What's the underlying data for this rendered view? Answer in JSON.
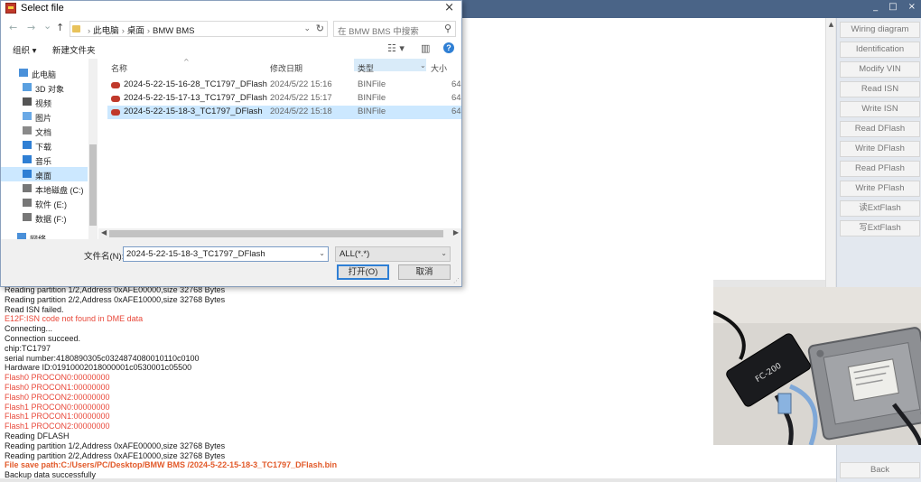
{
  "app": {
    "window_controls": [
      "_",
      "□",
      "×"
    ],
    "right_buttons": [
      "Wiring diagram",
      "Identification",
      "Modify VIN",
      "Read  ISN",
      "Write  ISN",
      "Read DFlash",
      "Write DFlash",
      "Read PFlash",
      "Write PFlash",
      "读ExtFlash",
      "写ExtFlash"
    ],
    "back_label": "Back",
    "scroll_up": "▲",
    "scroll_down": "▼",
    "photo_device_label": "FC-200"
  },
  "log": [
    {
      "text": "Reading partition 1/2,Address 0xAFE00000,size 32768 Bytes",
      "kind": "normal"
    },
    {
      "text": "Reading partition 2/2,Address 0xAFE10000,size 32768 Bytes",
      "kind": "normal"
    },
    {
      "text": "Read ISN failed.",
      "kind": "normal"
    },
    {
      "text": "E12F:ISN code not found in DME data",
      "kind": "err"
    },
    {
      "text": "Connecting...",
      "kind": "normal"
    },
    {
      "text": "Connection succeed.",
      "kind": "normal"
    },
    {
      "text": "chip:TC1797",
      "kind": "normal"
    },
    {
      "text": "serial number:4180890305c0324874080010110c0100",
      "kind": "normal"
    },
    {
      "text": "Hardware ID:01910002018000001c0530001c05500",
      "kind": "normal"
    },
    {
      "text": "Flash0 PROCON0:00000000",
      "kind": "err"
    },
    {
      "text": "Flash0 PROCON1:00000000",
      "kind": "err"
    },
    {
      "text": "Flash0 PROCON2:00000000",
      "kind": "err"
    },
    {
      "text": "Flash1 PROCON0:00000000",
      "kind": "err"
    },
    {
      "text": "Flash1 PROCON1:00000000",
      "kind": "err"
    },
    {
      "text": "Flash1 PROCON2:00000000",
      "kind": "err"
    },
    {
      "text": "Reading DFLASH",
      "kind": "normal"
    },
    {
      "text": "Reading partition 1/2,Address 0xAFE00000,size 32768 Bytes",
      "kind": "normal"
    },
    {
      "text": "Reading partition 2/2,Address 0xAFE10000,size 32768 Bytes",
      "kind": "normal"
    },
    {
      "text": "File save path:C:/Users/PC/Desktop/BMW BMS /2024-5-22-15-18-3_TC1797_DFlash.bin",
      "kind": "warn"
    },
    {
      "text": "Backup data successfully",
      "kind": "normal"
    }
  ],
  "dialog": {
    "title": "Select file",
    "close": "×",
    "nav": {
      "back": "←",
      "forward": "→",
      "recent": "⌄",
      "up": "↑"
    },
    "breadcrumb": [
      "此电脑",
      "桌面",
      "BMW BMS"
    ],
    "search_placeholder": "在 BMW BMS    中搜索",
    "toolbar": {
      "organize": "组织 ▾",
      "new_folder": "新建文件夹",
      "help": "?"
    },
    "nav_items": [
      {
        "label": "此电脑",
        "icon": "pc-icon",
        "color": "#4a90d9"
      },
      {
        "label": "3D 对象",
        "icon": "cube-icon",
        "color": "#5aa0e0"
      },
      {
        "label": "视频",
        "icon": "video-icon",
        "color": "#555"
      },
      {
        "label": "图片",
        "icon": "picture-icon",
        "color": "#6aa9e6"
      },
      {
        "label": "文档",
        "icon": "document-icon",
        "color": "#8a8a8a"
      },
      {
        "label": "下载",
        "icon": "download-icon",
        "color": "#2f7fd4"
      },
      {
        "label": "音乐",
        "icon": "music-icon",
        "color": "#2f7fd4"
      },
      {
        "label": "桌面",
        "icon": "desktop-icon",
        "color": "#2f7fd4"
      },
      {
        "label": "本地磁盘 (C:)",
        "icon": "drive-icon",
        "color": "#777"
      },
      {
        "label": "软件 (E:)",
        "icon": "drive-icon",
        "color": "#777"
      },
      {
        "label": "数据 (F:)",
        "icon": "drive-icon",
        "color": "#777"
      },
      {
        "label": "网络",
        "icon": "network-icon",
        "color": "#4a90d9"
      }
    ],
    "columns": [
      "名称",
      "修改日期",
      "类型",
      "大小"
    ],
    "files": [
      {
        "name": "2024-5-22-15-16-28_TC1797_DFlash",
        "date": "2024/5/22 15:16",
        "type": "BINFile",
        "size": "64"
      },
      {
        "name": "2024-5-22-15-17-13_TC1797_DFlash",
        "date": "2024/5/22 15:17",
        "type": "BINFile",
        "size": "64"
      },
      {
        "name": "2024-5-22-15-18-3_TC1797_DFlash",
        "date": "2024/5/22 15:18",
        "type": "BINFile",
        "size": "64"
      }
    ],
    "filename_label": "文件名(N):",
    "filename_value": "2024-5-22-15-18-3_TC1797_DFlash",
    "filetype_value": "ALL(*.*)",
    "open_label": "打开(O)",
    "cancel_label": "取消"
  }
}
